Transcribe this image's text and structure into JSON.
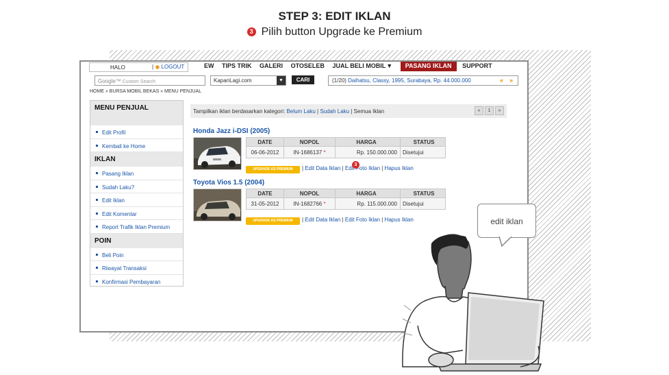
{
  "header": {
    "step_title": "STEP 3: EDIT IKLAN",
    "step_badge": "3",
    "instruction": "Pilih button Upgrade ke Premium"
  },
  "topbar": {
    "greeting": "HALO",
    "logout": "LOGOUT",
    "nav": [
      "EW",
      "TIPS TRIK",
      "GALERI",
      "OTOSELEB",
      "JUAL BELI MOBIL"
    ],
    "nav_highlight": "PASANG IKLAN",
    "nav_support": "SUPPORT"
  },
  "searchbar": {
    "search_placeholder": "Custom Search",
    "site_select": "KapanLagi.com",
    "search_button": "CARI",
    "ticker_count": "(1/20)",
    "ticker_text": "Daihatsu, Classy, 1995, Surabaya, Rp. 44.000.000"
  },
  "breadcrumb": "HOME » BURSA MOBIL BEKAS » MENU PENJUAL",
  "sidebar": {
    "sections": [
      {
        "title": "MENU PENJUAL",
        "items": [
          "Edit Profil",
          "Kembali ke Home"
        ]
      },
      {
        "title": "IKLAN",
        "items": [
          "Pasang Iklan",
          "Sudah Laku?",
          "Edit Iklan",
          "Edit Komentar",
          "Report Trafik Iklan Premium"
        ]
      },
      {
        "title": "POIN",
        "items": [
          "Beli Poin",
          "Riwayat Transaksi",
          "Konfirmasi Pembayaran"
        ]
      }
    ]
  },
  "filter": {
    "prefix": "Tampilkan iklan berdasarkan kategori:",
    "belum_laku": "Belum Laku",
    "sudah_laku": "Sudah Laku",
    "semua": "Semua Iklan",
    "pager": [
      "«",
      "1",
      "»"
    ]
  },
  "table_headers": [
    "DATE",
    "NOPOL",
    "HARGA",
    "STATUS"
  ],
  "listings": [
    {
      "title": "Honda Jazz i-DSI (2005)",
      "date": "06-06-2012",
      "nopol": "IN-1686137",
      "harga": "Rp. 150.000.000",
      "status": "Disetujui"
    },
    {
      "title": "Toyota Vios 1.5 (2004)",
      "date": "31-05-2012",
      "nopol": "IN-1682766",
      "harga": "Rp. 115.000.000",
      "status": "Disetujui"
    }
  ],
  "actions": {
    "upgrade": "UPGRADE KE PREMIUM",
    "edit_data": "Edit Data Iklan",
    "edit_foto": "Edit Foto Iklan",
    "hapus": "Hapus Iklan",
    "asterisk": "*"
  },
  "bubble": "edit iklan",
  "colors": {
    "accent_red": "#a01a1a",
    "link_blue": "#1a55a8",
    "upgrade_yellow": "#f5b800",
    "badge_red": "#d62b2b"
  }
}
